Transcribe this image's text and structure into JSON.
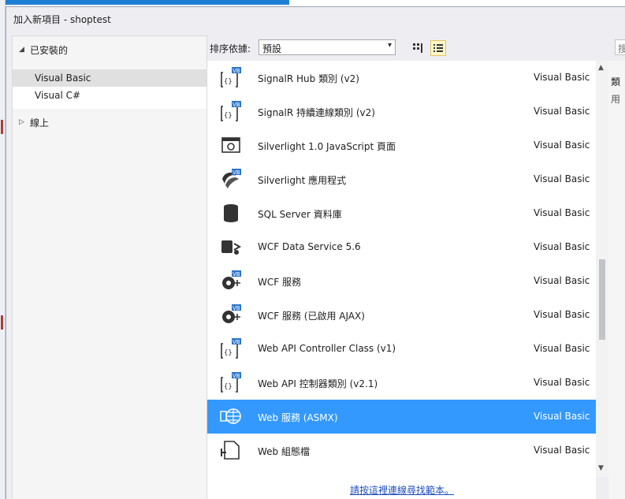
{
  "window": {
    "title": "加入新項目 - shoptest"
  },
  "tree": {
    "installed": {
      "label": "已安裝的",
      "expander": "◢"
    },
    "children": [
      {
        "label": "Visual Basic",
        "selected": true
      },
      {
        "label": "Visual C#",
        "selected": false
      }
    ],
    "online": {
      "label": "線上",
      "expander": "▷"
    }
  },
  "toolbar": {
    "sort_label": "排序依據:",
    "sort_value": "預設",
    "dropdown_glyph": "▾",
    "search_placeholder": "搜"
  },
  "items": [
    {
      "name": "SignalR Hub 類別 (v2)",
      "lang": "Visual Basic",
      "icon": "vb-class-icon",
      "selected": false
    },
    {
      "name": "SignalR 持續連線類別 (v2)",
      "lang": "Visual Basic",
      "icon": "vb-class-icon",
      "selected": false
    },
    {
      "name": "Silverlight 1.0 JavaScript 頁面",
      "lang": "Visual Basic",
      "icon": "silverlight-page-icon",
      "selected": false
    },
    {
      "name": "Silverlight 應用程式",
      "lang": "Visual Basic",
      "icon": "silverlight-app-icon",
      "selected": false
    },
    {
      "name": "SQL Server 資料庫",
      "lang": "Visual Basic",
      "icon": "database-icon",
      "selected": false
    },
    {
      "name": "WCF Data Service 5.6",
      "lang": "Visual Basic",
      "icon": "data-service-icon",
      "selected": false
    },
    {
      "name": "WCF 服務",
      "lang": "Visual Basic",
      "icon": "wcf-service-icon",
      "selected": false
    },
    {
      "name": "WCF 服務 (已啟用 AJAX)",
      "lang": "Visual Basic",
      "icon": "wcf-service-icon",
      "selected": false
    },
    {
      "name": "Web API Controller Class (v1)",
      "lang": "Visual Basic",
      "icon": "vb-class-icon",
      "selected": false
    },
    {
      "name": "Web API 控制器類別 (v2.1)",
      "lang": "Visual Basic",
      "icon": "vb-class-icon",
      "selected": false
    },
    {
      "name": "Web 服務 (ASMX)",
      "lang": "Visual Basic",
      "icon": "web-service-icon",
      "selected": true
    },
    {
      "name": "Web 組態檔",
      "lang": "Visual Basic",
      "icon": "config-file-icon",
      "selected": false
    }
  ],
  "more_link": "請按這裡連線尋找範本。",
  "details": {
    "line1": "類",
    "line2": "用"
  },
  "colors": {
    "selection": "#3399ff",
    "window_bg": "#eeeef2",
    "link": "#1f4fbf"
  }
}
